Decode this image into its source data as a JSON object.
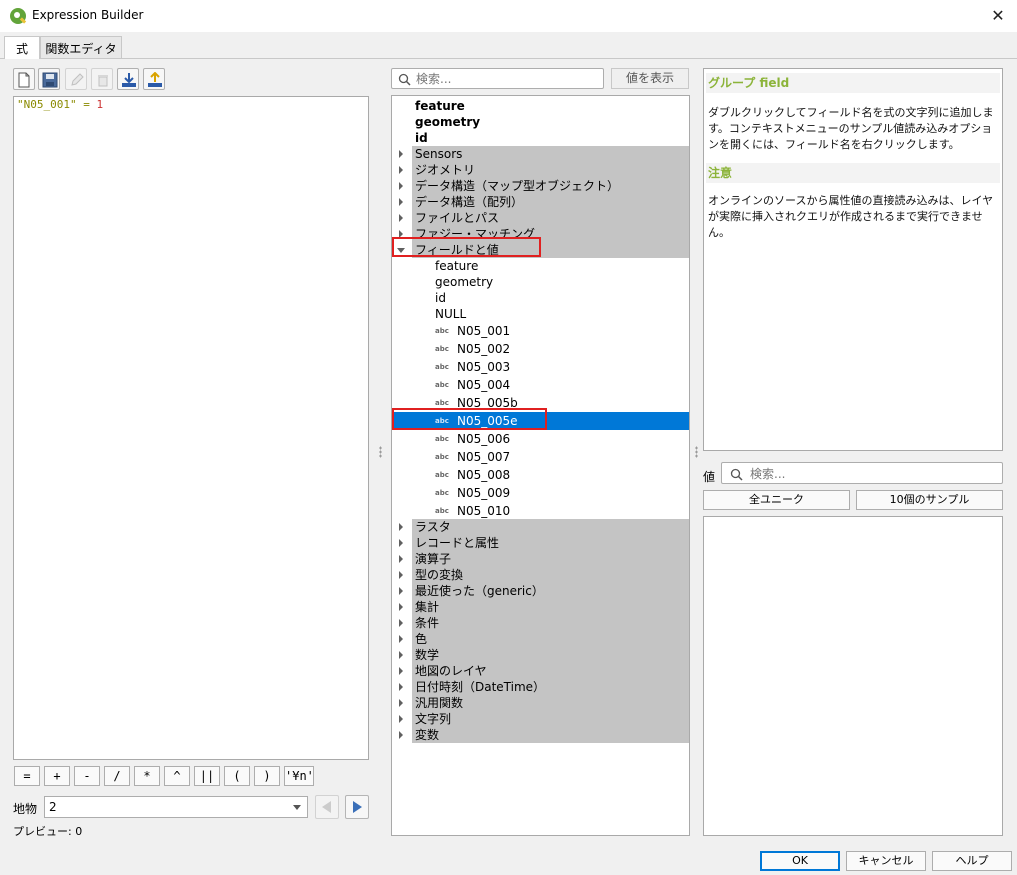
{
  "window": {
    "title": "Expression Builder",
    "close_glyph": "✕"
  },
  "tabs": [
    {
      "label": "式",
      "active": true
    },
    {
      "label": "関数エディタ",
      "active": false
    }
  ],
  "toolbar": {
    "icons": [
      "new-file-icon",
      "save-icon",
      "edit-icon",
      "delete-icon",
      "import-icon",
      "export-icon"
    ]
  },
  "editor": {
    "field": "\"N05_001\"",
    "operator": " = ",
    "number": "1"
  },
  "operators": [
    "=",
    "+",
    "-",
    "/",
    "*",
    "^",
    "||",
    "(",
    ")",
    "'¥n'"
  ],
  "feature": {
    "label": "地物",
    "value": "2"
  },
  "preview": {
    "label": "プレビュー: 0"
  },
  "search": {
    "placeholder": "検索..."
  },
  "show_values_label": "値を表示",
  "tree": {
    "top_items": [
      "feature",
      "geometry",
      "id"
    ],
    "groups_before": [
      "Sensors",
      "ジオメトリ",
      "データ構造（マップ型オブジェクト）",
      "データ構造（配列）",
      "ファイルとパス",
      "ファジー・マッチング"
    ],
    "expanded_group": "フィールドと値",
    "expanded_children": [
      "feature",
      "geometry",
      "id",
      "NULL"
    ],
    "fields": [
      "N05_001",
      "N05_002",
      "N05_003",
      "N05_004",
      "N05_005b",
      "N05_005e",
      "N05_006",
      "N05_007",
      "N05_008",
      "N05_009",
      "N05_010"
    ],
    "field_type_badge": "abc",
    "selected_field": "N05_005e",
    "groups_after": [
      "ラスタ",
      "レコードと属性",
      "演算子",
      "型の変換",
      "最近使った（generic）",
      "集計",
      "条件",
      "色",
      "数学",
      "地図のレイヤ",
      "日付時刻（DateTime）",
      "汎用関数",
      "文字列",
      "変数"
    ]
  },
  "help": {
    "title": "グループ field",
    "body": "ダブルクリックしてフィールド名を式の文字列に追加します。コンテキストメニューのサンプル値読み込みオプションを開くには、フィールド名を右クリックします。",
    "note_title": "注意",
    "note_body": "オンラインのソースから属性値の直接読み込みは、レイヤが実際に挿入されクエリが作成されるまで実行できません。"
  },
  "values": {
    "label": "値",
    "search_placeholder": "検索...",
    "all_unique_label": "全ユニーク",
    "sample_label": "10個のサンプル"
  },
  "dialog_buttons": {
    "ok": "OK",
    "cancel": "キャンセル",
    "help": "ヘルプ"
  },
  "colors": {
    "selection": "#0078d7",
    "group_bg": "#c4c4c4",
    "highlight_box": "#e02020",
    "help_heading": "#8cb43a"
  }
}
